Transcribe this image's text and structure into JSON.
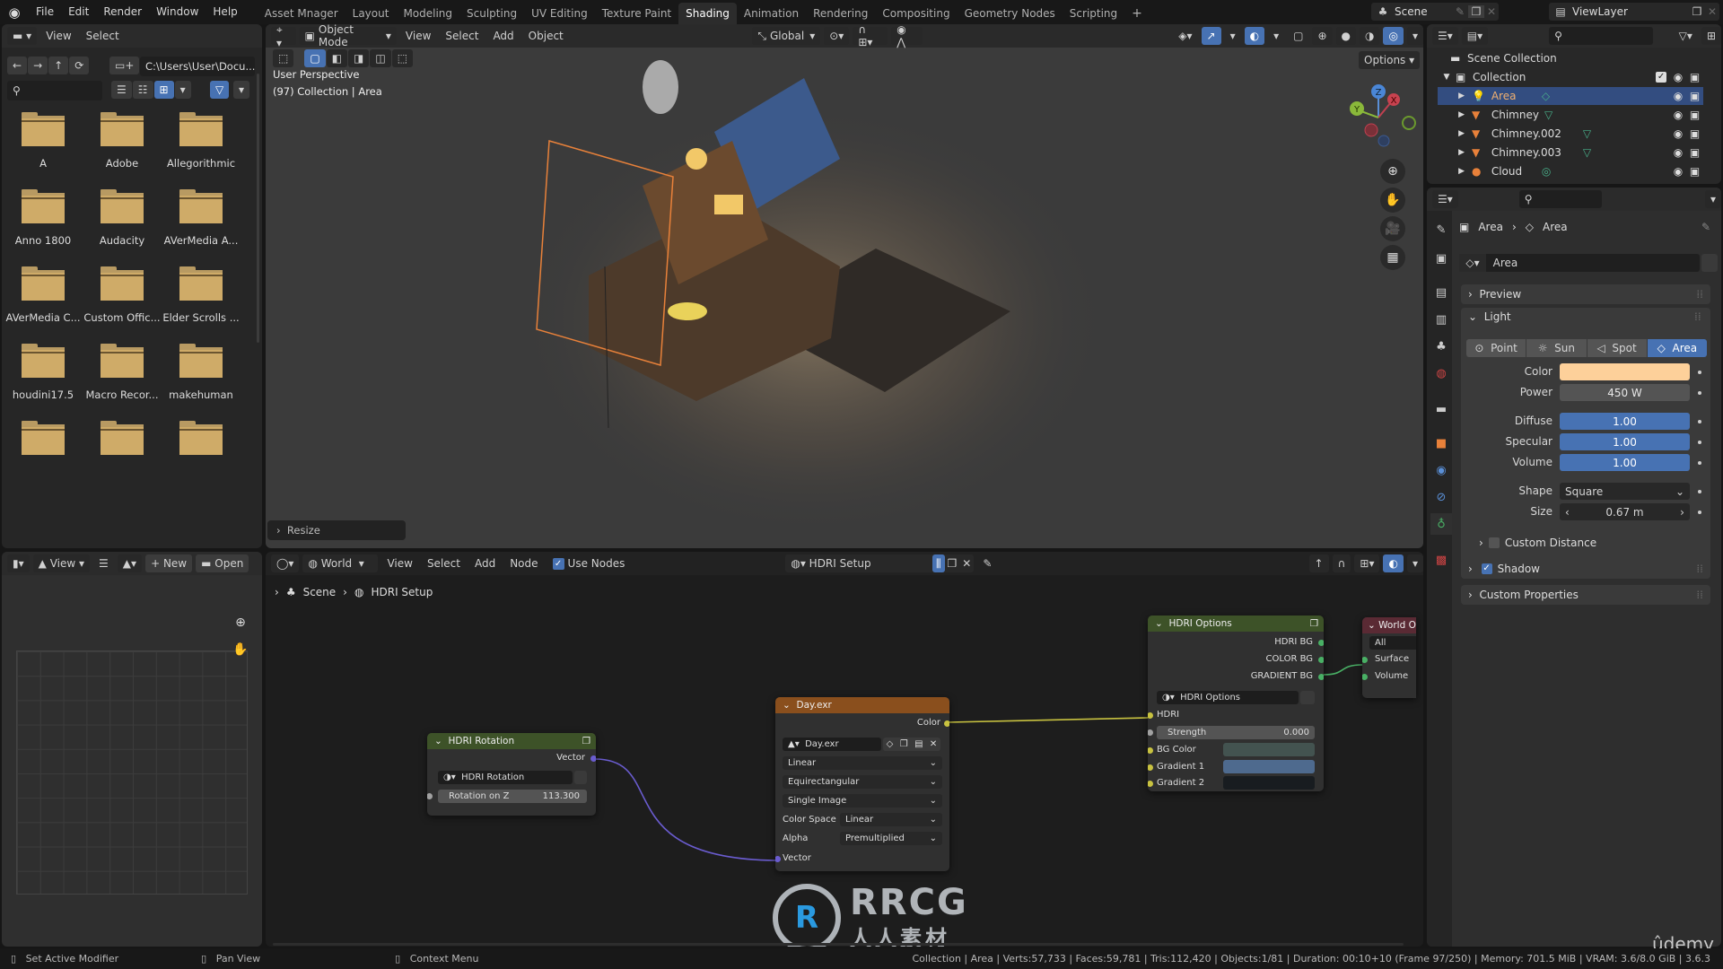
{
  "topbar": {
    "menus": [
      "File",
      "Edit",
      "Render",
      "Window",
      "Help"
    ],
    "workspaces": [
      "Asset Mnager",
      "Layout",
      "Modeling",
      "Sculpting",
      "UV Editing",
      "Texture Paint",
      "Shading",
      "Animation",
      "Rendering",
      "Compositing",
      "Geometry Nodes",
      "Scripting"
    ],
    "active_workspace": "Shading",
    "add_workspace": "+",
    "scene": "Scene",
    "view_layer": "ViewLayer"
  },
  "file_browser": {
    "menus": [
      "View",
      "Select"
    ],
    "path": "C:\\Users\\User\\Docu...",
    "search_placeholder": "",
    "folders": [
      "A",
      "Adobe",
      "Allegorithmic",
      "Anno 1800",
      "Audacity",
      "AVerMedia A...",
      "AVerMedia C...",
      "Custom Offic...",
      "Elder Scrolls ...",
      "houdini17.5",
      "Macro Recor...",
      "makehuman",
      "",
      "",
      ""
    ]
  },
  "viewport": {
    "mode": "Object Mode",
    "menus": [
      "View",
      "Select",
      "Add",
      "Object"
    ],
    "orientation": "Global",
    "options_label": "Options",
    "overlay_line1": "User Perspective",
    "overlay_line2": "(97) Collection | Area",
    "last_op": "Resize",
    "gizmo": {
      "z": "Z",
      "x": "X",
      "y": "Y"
    }
  },
  "image_editor": {
    "view_label": "View",
    "new_label": "New",
    "open_label": "Open"
  },
  "node_editor": {
    "world_label": "World",
    "menus": [
      "View",
      "Select",
      "Add",
      "Node"
    ],
    "use_nodes_label": "Use Nodes",
    "use_nodes": true,
    "node_tree": "HDRI Setup",
    "breadcrumb": [
      "Scene",
      "HDRI Setup"
    ],
    "nodes": {
      "hdri_rotation": {
        "title": "HDRI Rotation",
        "output": "Vector",
        "group": "HDRI Rotation",
        "field_label": "Rotation on Z",
        "field_value": "113.300"
      },
      "day_exr": {
        "title": "Day.exr",
        "output": "Color",
        "image": "Day.exr",
        "interpolation": "Linear",
        "projection": "Equirectangular",
        "source": "Single Image",
        "color_space_label": "Color Space",
        "color_space": "Linear",
        "alpha_label": "Alpha",
        "alpha": "Premultiplied",
        "input": "Vector"
      },
      "hdri_options": {
        "title": "HDRI Options",
        "outputs": [
          "HDRI BG",
          "COLOR BG",
          "GRADIENT BG"
        ],
        "group": "HDRI Options",
        "inputs": {
          "hdri": "HDRI",
          "strength_label": "Strength",
          "strength_value": "0.000",
          "bg_color": "BG Color",
          "gradient1": "Gradient 1",
          "gradient2": "Gradient 2"
        },
        "colors": {
          "bg_color": "#435350",
          "gradient1": "#4e6a8e",
          "gradient2": "#181c20"
        }
      },
      "world_output": {
        "title": "World Output",
        "target": "All",
        "inputs": [
          "Surface",
          "Volume"
        ]
      }
    }
  },
  "outliner": {
    "search_placeholder": "",
    "scene_collection": "Scene Collection",
    "collection": "Collection",
    "items": [
      {
        "name": "Area",
        "type": "light",
        "selected": true
      },
      {
        "name": "Chimney",
        "type": "mesh",
        "selected": false
      },
      {
        "name": "Chimney.002",
        "type": "mesh",
        "selected": false
      },
      {
        "name": "Chimney.003",
        "type": "mesh",
        "selected": false
      },
      {
        "name": "Cloud",
        "type": "metaball",
        "selected": false
      }
    ]
  },
  "properties": {
    "breadcrumb": [
      "Area",
      "Area"
    ],
    "datablock": "Area",
    "sections": {
      "preview": "Preview",
      "light": "Light",
      "shadow": "Shadow",
      "custom_properties": "Custom Properties",
      "custom_distance": "Custom Distance"
    },
    "light_types": [
      "Point",
      "Sun",
      "Spot",
      "Area"
    ],
    "active_light_type": "Area",
    "fields": {
      "color_label": "Color",
      "color_value": "#fdd09a",
      "power_label": "Power",
      "power_value": "450 W",
      "diffuse_label": "Diffuse",
      "diffuse_value": "1.00",
      "specular_label": "Specular",
      "specular_value": "1.00",
      "volume_label": "Volume",
      "volume_value": "1.00",
      "shape_label": "Shape",
      "shape_value": "Square",
      "size_label": "Size",
      "size_value": "0.67 m"
    },
    "shadow_enabled": true,
    "custom_distance_enabled": false
  },
  "statusbar": {
    "left_hints": [
      "Set Active Modifier",
      "Pan View",
      "Context Menu"
    ],
    "stats": "Collection | Area | Verts:57,733 | Faces:59,781 | Tris:112,420 | Objects:1/81 | Duration: 00:10+10 (Frame 97/250) | Memory: 701.5 MiB | VRAM: 3.6/8.0 GiB | 3.6.3"
  },
  "watermarks": {
    "rrcg": "RRCG",
    "rrcg_sub": "人人素材",
    "udemy": "ûdemy"
  },
  "colors": {
    "accent": "#4772b3",
    "selection": "#334d80",
    "folder": "#cfab68",
    "light_color": "#fdd09a"
  }
}
